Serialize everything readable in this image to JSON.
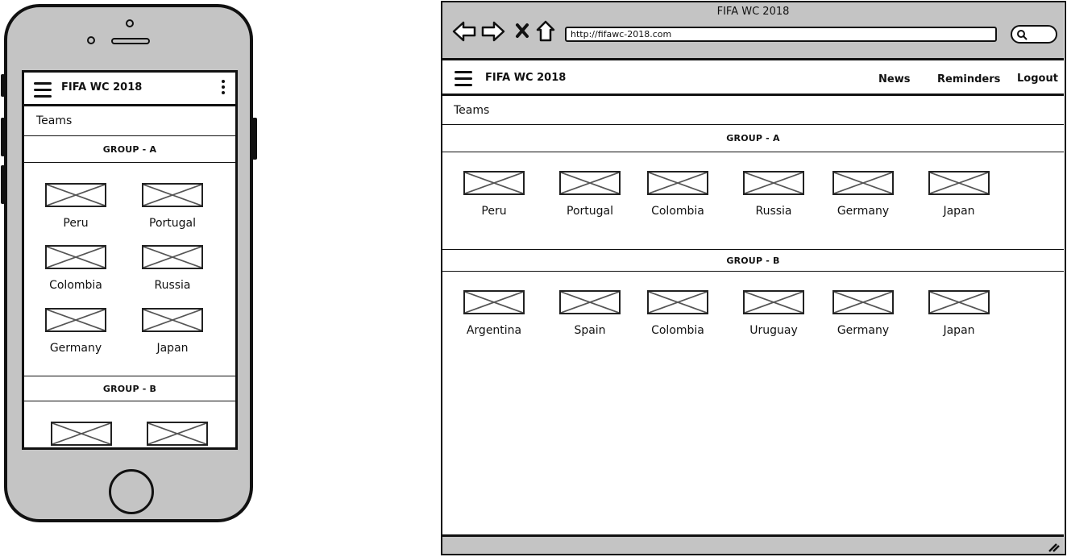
{
  "mobile": {
    "app_title": "FIFA WC 2018",
    "section_title": "Teams",
    "group_a": {
      "label": "GROUP - A",
      "teams": [
        "Peru",
        "Portugal",
        "Colombia",
        "Russia",
        "Germany",
        "Japan"
      ]
    },
    "group_b": {
      "label": "GROUP - B"
    }
  },
  "browser": {
    "window_title": "FIFA WC 2018",
    "url": "http://fifawc-2018.com",
    "app_title": "FIFA WC 2018",
    "nav": {
      "news": "News",
      "reminders": "Reminders",
      "logout": "Logout"
    },
    "section_title": "Teams",
    "group_a": {
      "label": "GROUP - A",
      "teams": [
        "Peru",
        "Portugal",
        "Colombia",
        "Russia",
        "Germany",
        "Japan"
      ]
    },
    "group_b": {
      "label": "GROUP - B",
      "teams": [
        "Argentina",
        "Spain",
        "Colombia",
        "Uruguay",
        "Germany",
        "Japan"
      ]
    }
  },
  "colors": {
    "frame_gray": "#c4c4c4",
    "ink": "#111111"
  },
  "icons": [
    "menu-icon",
    "more-vertical-icon",
    "back-arrow-icon",
    "forward-arrow-icon",
    "stop-icon",
    "home-icon",
    "search-icon",
    "resize-grip-icon",
    "image-placeholder-icon"
  ]
}
